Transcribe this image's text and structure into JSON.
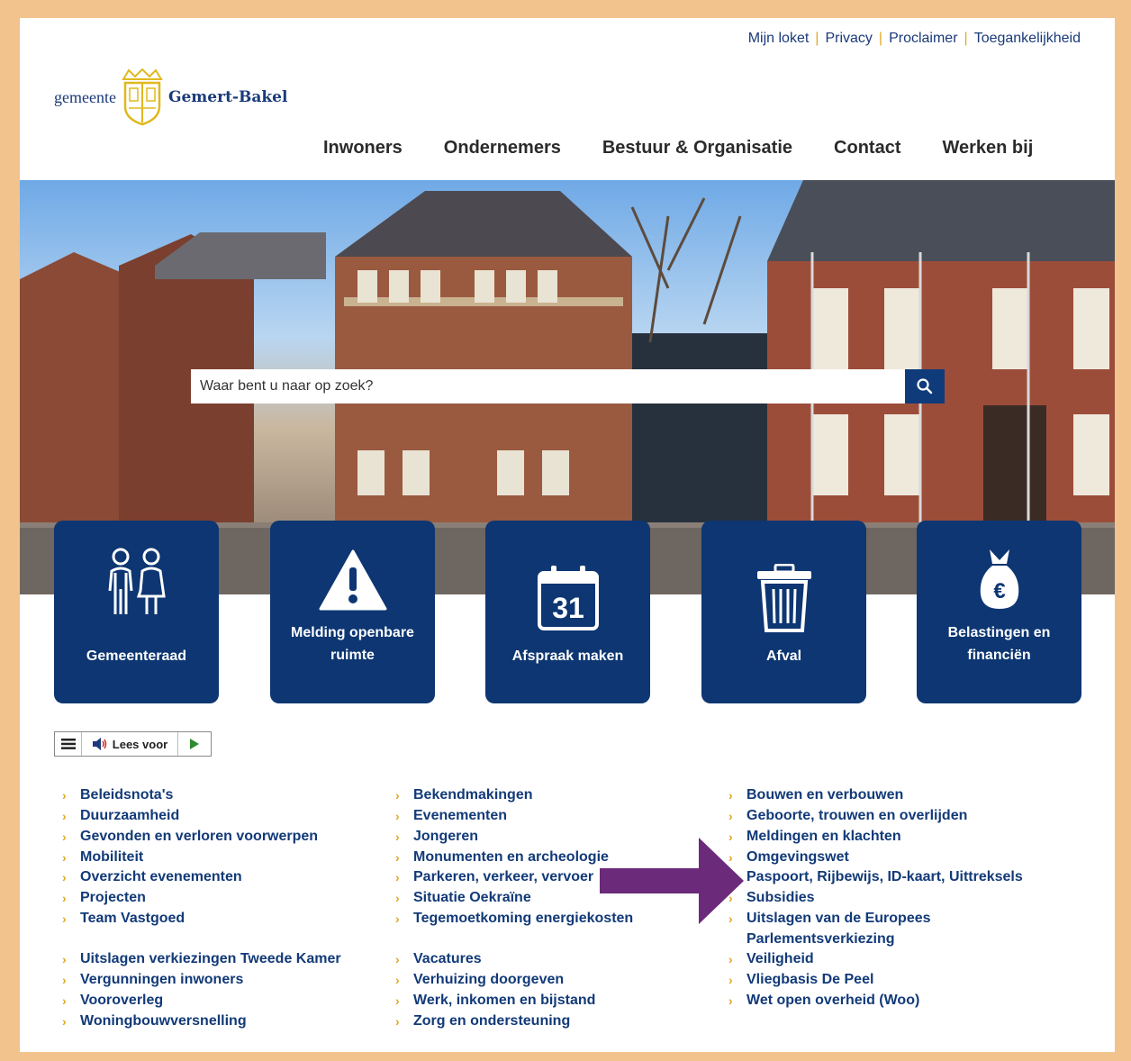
{
  "toplinks": [
    "Mijn loket",
    "Privacy",
    "Proclaimer",
    "Toegankelijkheid"
  ],
  "logo": {
    "word1": "gemeente",
    "word2": "Gemert-Bakel"
  },
  "mainnav": [
    "Inwoners",
    "Ondernemers",
    "Bestuur & Organisatie",
    "Contact",
    "Werken bij"
  ],
  "search": {
    "placeholder": "Waar bent u naar op zoek?",
    "icon": "search-icon"
  },
  "tiles": [
    {
      "label": "Gemeenteraad",
      "icon": "people-icon"
    },
    {
      "label_line1": "Melding openbare",
      "label_line2": "ruimte",
      "icon": "warning-icon"
    },
    {
      "label": "Afspraak maken",
      "icon": "calendar-icon",
      "calendar_day": "31"
    },
    {
      "label": "Afval",
      "icon": "trash-bin-icon"
    },
    {
      "label_line1": "Belastingen en",
      "label_line2": "financiën",
      "icon": "money-bag-icon",
      "currency": "€"
    }
  ],
  "readaloud": {
    "label": "Lees voor"
  },
  "columns": [
    [
      "Beleidsnota's",
      "Duurzaamheid",
      "Gevonden en verloren voorwerpen",
      "Mobiliteit",
      "Overzicht evenementen",
      "Projecten",
      "Team Vastgoed",
      "Uitslagen verkiezingen Tweede Kamer",
      "Vergunningen inwoners",
      "Vooroverleg",
      "Woningbouwversnelling"
    ],
    [
      "Bekendmakingen",
      "Evenementen",
      "Jongeren",
      "Monumenten en archeologie",
      "Parkeren, verkeer, vervoer",
      "Situatie Oekraïne",
      "Tegemoetkoming energiekosten",
      "Vacatures",
      "Verhuizing doorgeven",
      "Werk, inkomen en bijstand",
      "Zorg en ondersteuning"
    ],
    [
      "Bouwen en verbouwen",
      "Geboorte, trouwen en overlijden",
      "Meldingen en klachten",
      "Omgevingswet",
      "Paspoort, Rijbewijs, ID-kaart, Uittreksels",
      "Subsidies",
      "Uitslagen van de Europees",
      "Parlementsverkiezing",
      "Veiligheid",
      "Vliegbasis De Peel",
      "Wet open overheid (Woo)"
    ]
  ],
  "colors": {
    "brand_navy": "#0d3672",
    "accent_gold": "#e0a821",
    "frame": "#f2c38c",
    "annotation_arrow": "#6b2a7a"
  }
}
